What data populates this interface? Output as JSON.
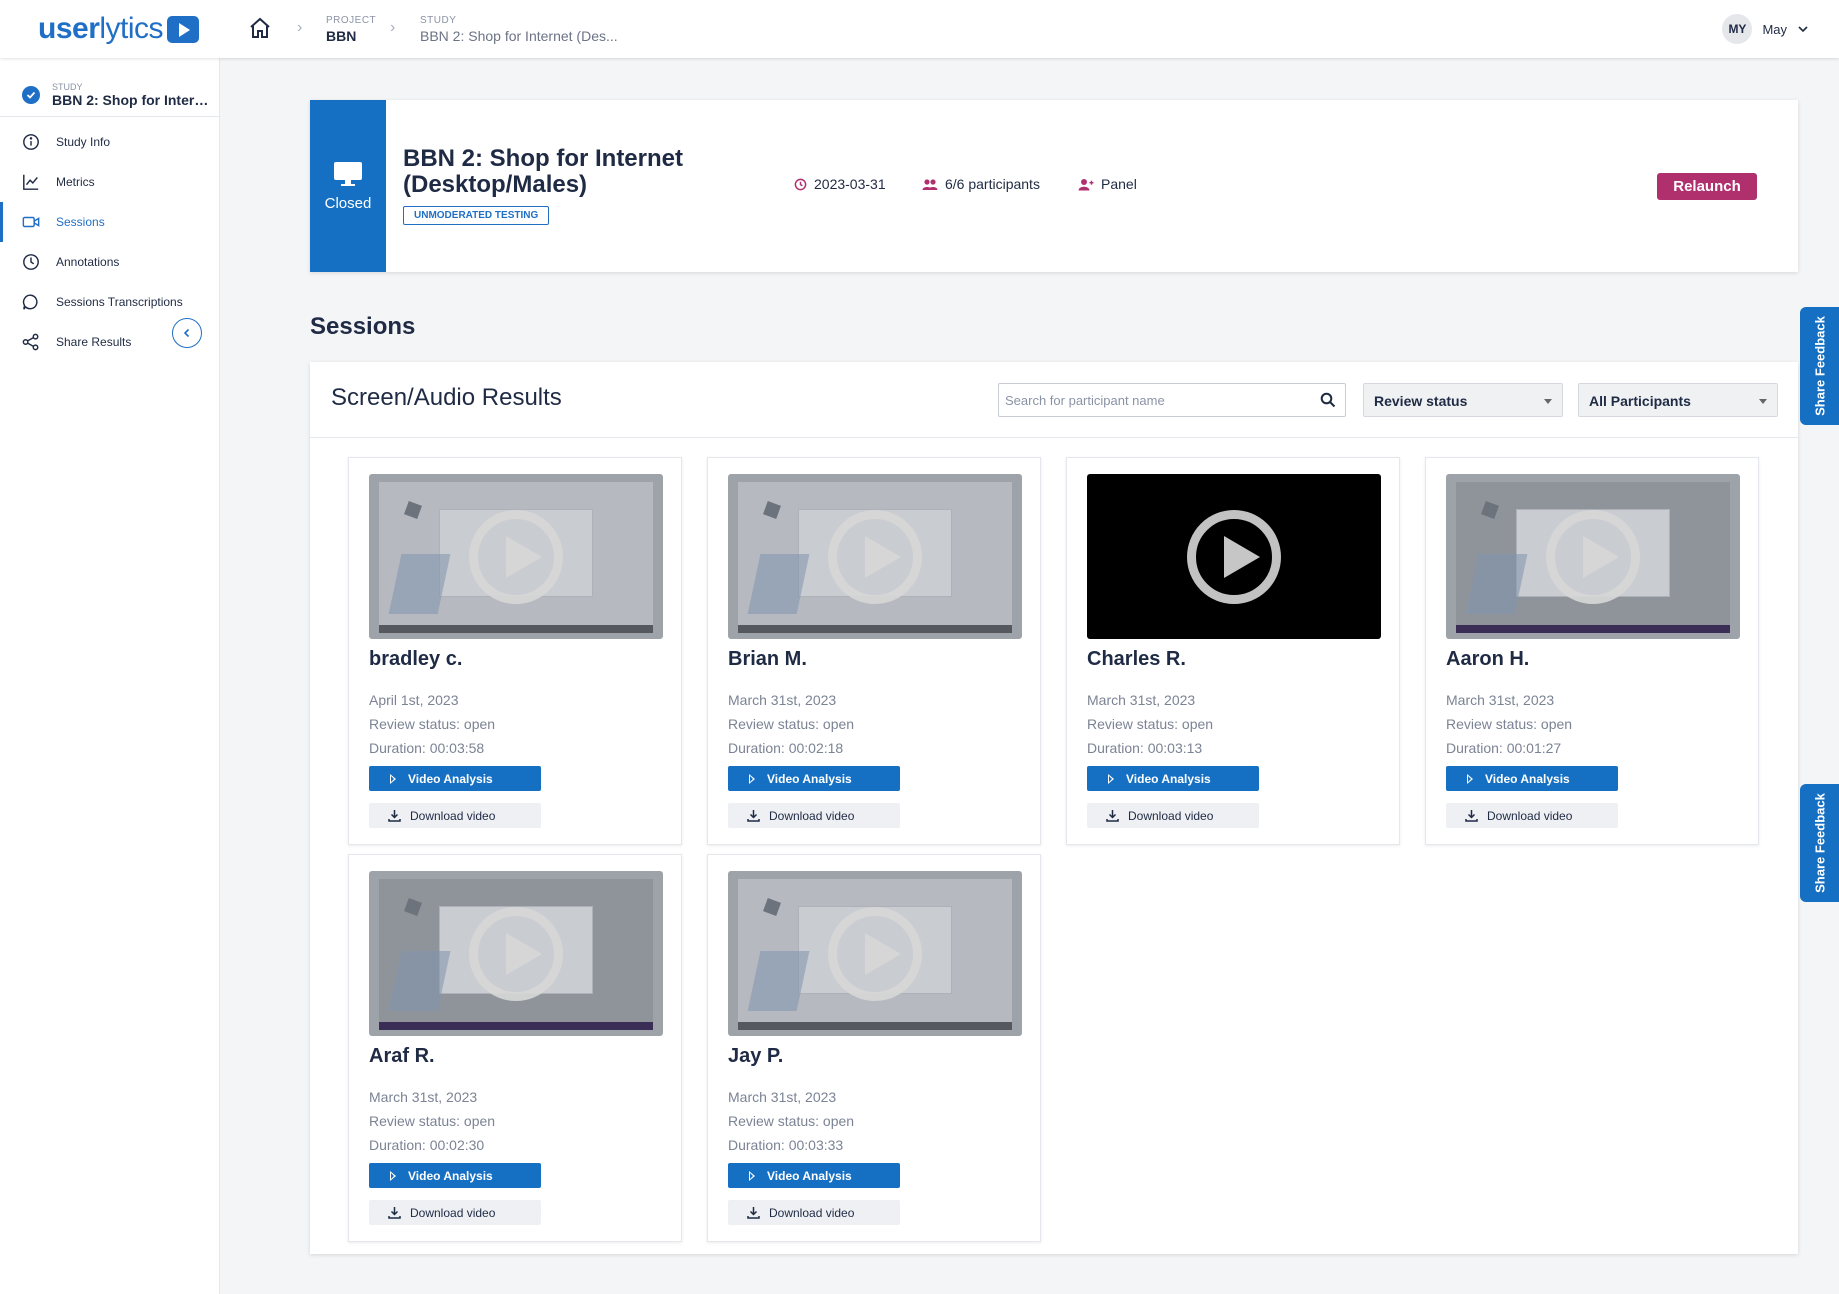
{
  "header": {
    "logo_bold": "user",
    "logo_light": "lytics",
    "breadcrumb": [
      {
        "key": "PROJECT",
        "value": "BBN"
      },
      {
        "key": "STUDY",
        "value": "BBN 2: Shop for Internet (Des..."
      }
    ],
    "user": {
      "initials": "MY",
      "name": "May"
    }
  },
  "sidebar": {
    "study_key": "STUDY",
    "study_name": "BBN 2: Shop for Interne...",
    "items": [
      {
        "label": "Study Info",
        "icon": "info-icon"
      },
      {
        "label": "Metrics",
        "icon": "chart-icon"
      },
      {
        "label": "Sessions",
        "icon": "video-icon",
        "active": true
      },
      {
        "label": "Annotations",
        "icon": "clock-icon"
      },
      {
        "label": "Sessions Transcriptions",
        "icon": "chat-icon"
      },
      {
        "label": "Share Results",
        "icon": "share-icon"
      }
    ]
  },
  "study": {
    "status": "Closed",
    "title": "BBN 2: Shop for Internet (Desktop/Males)",
    "tag": "UNMODERATED TESTING",
    "date": "2023-03-31",
    "participants": "6/6 participants",
    "panel": "Panel",
    "relaunch_label": "Relaunch"
  },
  "sessions_title": "Sessions",
  "results": {
    "title": "Screen/Audio Results",
    "search_placeholder": "Search for participant name",
    "review_filter": "Review status",
    "participants_filter": "All Participants",
    "video_analysis_label": "Video Analysis",
    "download_label": "Download video",
    "cards": [
      {
        "name": "bradley c.",
        "date": "April 1st, 2023",
        "review": "Review status: open",
        "duration": "Duration: 00:03:58",
        "thumb": "gray"
      },
      {
        "name": "Brian M.",
        "date": "March 31st, 2023",
        "review": "Review status: open",
        "duration": "Duration: 00:02:18",
        "thumb": "gray"
      },
      {
        "name": "Charles R.",
        "date": "March 31st, 2023",
        "review": "Review status: open",
        "duration": "Duration: 00:03:13",
        "thumb": "black"
      },
      {
        "name": "Aaron H.",
        "date": "March 31st, 2023",
        "review": "Review status: open",
        "duration": "Duration: 00:01:27",
        "thumb": "dark"
      },
      {
        "name": "Araf R.",
        "date": "March 31st, 2023",
        "review": "Review status: open",
        "duration": "Duration: 00:02:30",
        "thumb": "dark"
      },
      {
        "name": "Jay P.",
        "date": "March 31st, 2023",
        "review": "Review status: open",
        "duration": "Duration: 00:03:33",
        "thumb": "gray"
      }
    ]
  },
  "feedback_label": "Share Feedback",
  "colors": {
    "primary": "#1570c3",
    "relaunch": "#b0306e",
    "participants_icon": "#b0306e"
  }
}
